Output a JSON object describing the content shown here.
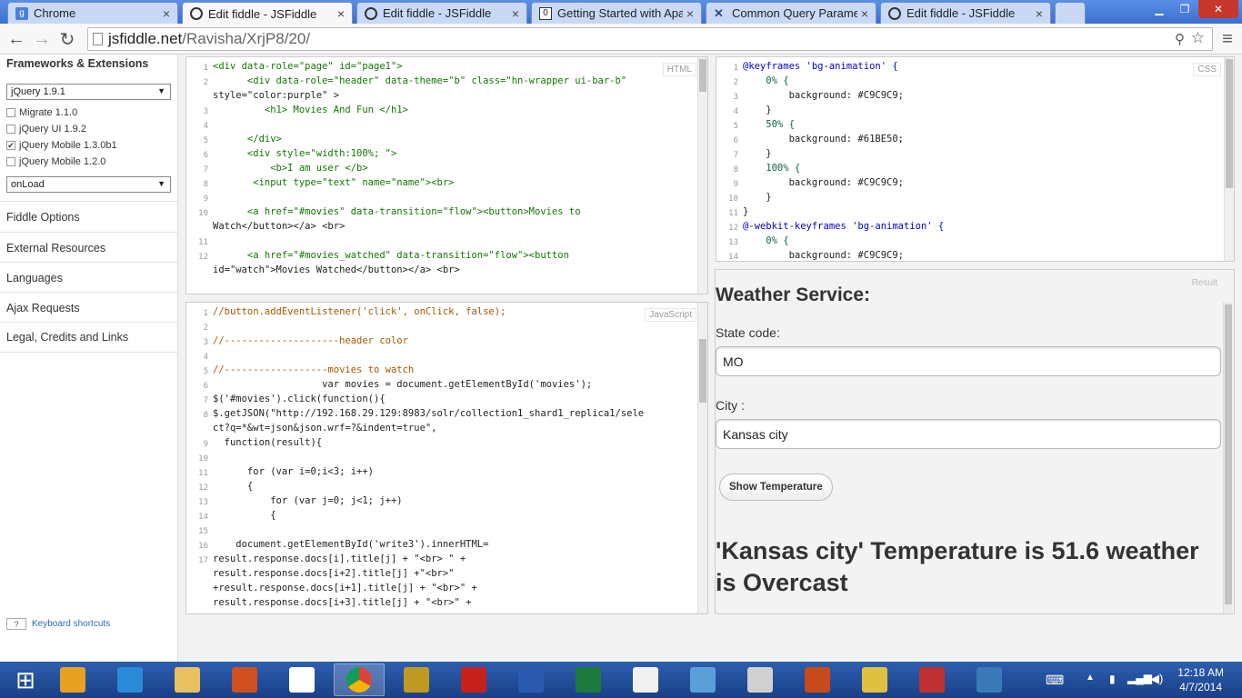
{
  "browser": {
    "tabs": [
      {
        "label": "Chrome",
        "active": false
      },
      {
        "label": "Edit fiddle - JSFiddle",
        "active": true
      },
      {
        "label": "Edit fiddle - JSFiddle",
        "active": false
      },
      {
        "label": "Getting Started with Apac",
        "active": false
      },
      {
        "label": "Common Query Paramete",
        "active": false
      },
      {
        "label": "Edit fiddle - JSFiddle",
        "active": false
      }
    ],
    "url_host": "jsfiddle.net",
    "url_path": "/Ravisha/XrjP8/20/"
  },
  "sidebar": {
    "title": "Frameworks & Extensions",
    "framework_select": "jQuery 1.9.1",
    "extensions": [
      {
        "label": "Migrate 1.1.0",
        "checked": false
      },
      {
        "label": "jQuery UI 1.9.2",
        "checked": false
      },
      {
        "label": "jQuery Mobile 1.3.0b1",
        "checked": true
      },
      {
        "label": "jQuery Mobile 1.2.0",
        "checked": false
      }
    ],
    "load_select": "onLoad",
    "sections": [
      "Fiddle Options",
      "External Resources",
      "Languages",
      "Ajax Requests",
      "Legal, Credits and Links"
    ],
    "kbd_key": "?",
    "kbd_label": "Keyboard shortcuts"
  },
  "editors": {
    "html_label": "HTML",
    "css_label": "CSS",
    "js_label": "JavaScript",
    "result_label": "Result",
    "html_lines": [
      {
        "n": "1",
        "t": "<div data-role=\"page\" id=\"page1\">"
      },
      {
        "n": "2",
        "t": "      <div data-role=\"header\" data-theme=\"b\" class=\"hn-wrapper ui-bar-b\""
      },
      {
        "n": "",
        "t": "style=\"color:purple\" >"
      },
      {
        "n": "3",
        "t": "         <h1> Movies And Fun </h1>"
      },
      {
        "n": "4",
        "t": ""
      },
      {
        "n": "5",
        "t": "      </div>"
      },
      {
        "n": "6",
        "t": "      <div style=\"width:100%; \">"
      },
      {
        "n": "7",
        "t": "          <b>I am user </b>"
      },
      {
        "n": "8",
        "t": "       <input type=\"text\" name=\"name\"><br>"
      },
      {
        "n": "9",
        "t": ""
      },
      {
        "n": "10",
        "t": "      <a href=\"#movies\" data-transition=\"flow\"><button>Movies to"
      },
      {
        "n": "",
        "t": "Watch</button></a> <br>"
      },
      {
        "n": "11",
        "t": ""
      },
      {
        "n": "12",
        "t": "      <a href=\"#movies_watched\" data-transition=\"flow\"><button"
      },
      {
        "n": "",
        "t": "id=\"watch\">Movies Watched</button></a> <br>"
      }
    ],
    "css_lines": [
      {
        "n": "1",
        "t": "@keyframes 'bg-animation' {"
      },
      {
        "n": "2",
        "t": "    0% {"
      },
      {
        "n": "3",
        "t": "        background: #C9C9C9;"
      },
      {
        "n": "4",
        "t": "    }"
      },
      {
        "n": "5",
        "t": "    50% {"
      },
      {
        "n": "6",
        "t": "        background: #61BE50;"
      },
      {
        "n": "7",
        "t": "    }"
      },
      {
        "n": "8",
        "t": "    100% {"
      },
      {
        "n": "9",
        "t": "        background: #C9C9C9;"
      },
      {
        "n": "10",
        "t": "    }"
      },
      {
        "n": "11",
        "t": "}"
      },
      {
        "n": "12",
        "t": "@-webkit-keyframes 'bg-animation' {"
      },
      {
        "n": "13",
        "t": "    0% {"
      },
      {
        "n": "14",
        "t": "        background: #C9C9C9;"
      }
    ],
    "js_lines": [
      {
        "n": "1",
        "t": "//button.addEventListener('click', onClick, false);"
      },
      {
        "n": "2",
        "t": ""
      },
      {
        "n": "3",
        "t": "//--------------------header color"
      },
      {
        "n": "4",
        "t": ""
      },
      {
        "n": "5",
        "t": "//------------------movies to watch"
      },
      {
        "n": "6",
        "t": "                   var movies = document.getElementById('movies');"
      },
      {
        "n": "7",
        "t": "$('#movies').click(function(){"
      },
      {
        "n": "8",
        "t": "$.getJSON(\"http://192.168.29.129:8983/solr/collection1_shard1_replica1/sele"
      },
      {
        "n": "",
        "t": "ct?q=*&wt=json&json.wrf=?&indent=true\","
      },
      {
        "n": "9",
        "t": "  function(result){"
      },
      {
        "n": "10",
        "t": ""
      },
      {
        "n": "11",
        "t": "      for (var i=0;i<3; i++)"
      },
      {
        "n": "12",
        "t": "      {"
      },
      {
        "n": "13",
        "t": "          for (var j=0; j<1; j++)"
      },
      {
        "n": "14",
        "t": "          {"
      },
      {
        "n": "15",
        "t": ""
      },
      {
        "n": "16",
        "t": "    document.getElementById('write3').innerHTML="
      },
      {
        "n": "17",
        "t": "result.response.docs[i].title[j] + \"<br> \" +"
      },
      {
        "n": "",
        "t": "result.response.docs[i+2].title[j] +\"<br>\""
      },
      {
        "n": "",
        "t": "+result.response.docs[i+1].title[j] + \"<br>\" +"
      },
      {
        "n": "",
        "t": "result.response.docs[i+3].title[j] + \"<br>\" +"
      }
    ]
  },
  "result": {
    "heading": "Weather Service:",
    "state_label": "State code:",
    "state_value": "MO",
    "city_label": "City :",
    "city_value": "Kansas city",
    "button_label": "Show Temperature",
    "output": "'Kansas city' Temperature is 51.6 weather is Overcast"
  },
  "taskbar": {
    "apps": [
      "start-icon",
      "winamp-icon",
      "ie-icon",
      "explorer-icon",
      "paint-icon",
      "amazon-icon",
      "chrome-icon",
      "app-icon",
      "acrobat-icon",
      "word-icon",
      "excel-icon",
      "notepad-icon",
      "pen-icon",
      "calc-icon",
      "powerpoint-icon",
      "paint-brush-icon",
      "app2-icon",
      "photos-icon"
    ],
    "time": "12:18 AM",
    "date": "4/7/2014"
  }
}
